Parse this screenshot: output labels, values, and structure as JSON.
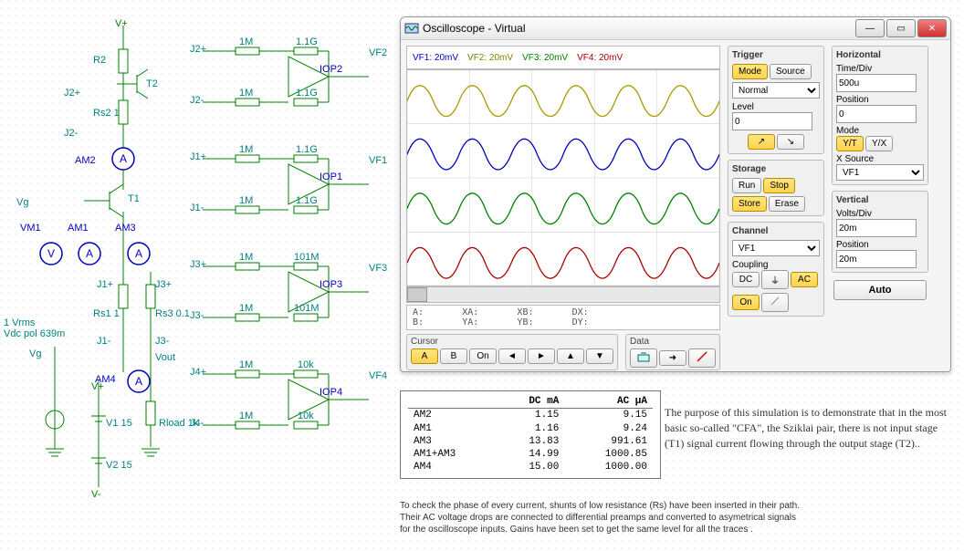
{
  "osc": {
    "title": "Oscilloscope - Virtual",
    "legend": {
      "vf1": "VF1: 20mV",
      "vf2": "VF2: 20mV",
      "vf3": "VF3: 20mV",
      "vf4": "VF4: 20mV"
    },
    "readout": {
      "a": "A:",
      "xa": "XA:",
      "xb": "XB:",
      "dx": "DX:",
      "b": "B:",
      "ya": "YA:",
      "yb": "YB:",
      "dy": "DY:"
    },
    "cursor": {
      "label": "Cursor",
      "a": "A",
      "b": "B",
      "on": "On",
      "prev": "◄",
      "next": "►",
      "up": "▲",
      "down": "▼"
    },
    "data": {
      "label": "Data"
    },
    "trigger": {
      "label": "Trigger",
      "mode": "Mode",
      "source": "Source",
      "normal": "Normal",
      "level": "Level",
      "levelval": "0",
      "rise": "↗",
      "fall": "↘"
    },
    "storage": {
      "label": "Storage",
      "run": "Run",
      "stop": "Stop",
      "store": "Store",
      "erase": "Erase"
    },
    "channel": {
      "label": "Channel",
      "sel": "VF1",
      "coupling": "Coupling",
      "dc": "DC",
      "gnd": "⏚",
      "ac": "AC",
      "on": "On"
    },
    "horizontal": {
      "label": "Horizontal",
      "timediv": "Time/Div",
      "timeval": "500u",
      "position": "Position",
      "posval": "0",
      "mode": "Mode",
      "yt": "Y/T",
      "yx": "Y/X",
      "xsource": "X Source",
      "xsrc": "VF1"
    },
    "vertical": {
      "label": "Vertical",
      "voltsdiv": "Volts/Div",
      "voltsval": "20m",
      "position": "Position",
      "posval": "20m"
    },
    "auto": "Auto"
  },
  "table": {
    "headers": {
      "dc": "DC  mA",
      "ac": "AC  µA"
    },
    "rows": [
      {
        "name": "AM2",
        "dc": "1.15",
        "ac": "9.15"
      },
      {
        "name": "AM1",
        "dc": "1.16",
        "ac": "9.24"
      },
      {
        "name": "AM3",
        "dc": "13.83",
        "ac": "991.61"
      },
      {
        "name": "AM1+AM3",
        "dc": "14.99",
        "ac": "1000.85"
      },
      {
        "name": "AM4",
        "dc": "15.00",
        "ac": "1000.00"
      }
    ]
  },
  "explain": "The purpose of this simulation is to demonstrate that in the most basic so-called \"CFA\", the Sziklai pair, there is not input stage (T1) signal current flowing through the output stage (T2)..",
  "footnote": "To check the phase of every current, shunts of low resistance (Rs) have been inserted in their path.\nTheir AC voltage drops are connected to differential preamps and converted to asymetrical signals\nfor the oscilloscope inputs. Gains have been set to get the same level for all the traces .",
  "sch": {
    "vplus": "V+",
    "vminus": "V-",
    "r2": "R2",
    "t1": "T1",
    "t2": "T2",
    "rs1": "Rs1 1",
    "rs2": "Rs2 1",
    "rs3": "Rs3 0.1",
    "rload": "Rload 1k",
    "j1p": "J1+",
    "j1m": "J1-",
    "j2p": "J2+",
    "j2m": "J2-",
    "j3p": "J3+",
    "j3m": "J3-",
    "j4p": "J4+",
    "j4m": "J4-",
    "vg": "Vg",
    "vm1": "VM1",
    "am1": "AM1",
    "am2": "AM2",
    "am3": "AM3",
    "am4": "AM4",
    "vout": "Vout",
    "v1": "V1 15",
    "v2": "V2 15",
    "src": "1 Vrms\nVdc pol 639m",
    "res1m": "1M",
    "res11g": "1.1G",
    "res101m": "101M",
    "res10k": "10k",
    "iop1": "IOP1",
    "iop2": "IOP2",
    "iop3": "IOP3",
    "iop4": "IOP4",
    "vf1": "VF1",
    "vf2": "VF2",
    "vf3": "VF3",
    "vf4": "VF4"
  }
}
